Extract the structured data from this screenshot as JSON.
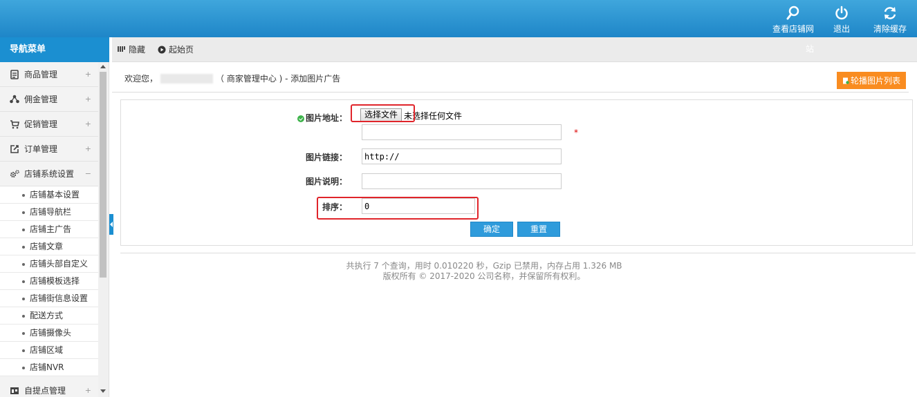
{
  "header": {
    "actions": [
      {
        "label": "查看店铺网",
        "icon": "search-icon"
      },
      {
        "label": "退出",
        "icon": "power-icon"
      },
      {
        "label": "清除缓存",
        "icon": "refresh-icon"
      }
    ],
    "overflow_text": "站",
    "background": "#1e86c8"
  },
  "sidebar": {
    "title": "导航菜单",
    "menus": [
      {
        "label": "商品管理",
        "icon": "product-icon",
        "toggle": "+"
      },
      {
        "label": "佣金管理",
        "icon": "commission-icon",
        "toggle": "+"
      },
      {
        "label": "促销管理",
        "icon": "cart-icon",
        "toggle": "+"
      },
      {
        "label": "订单管理",
        "icon": "order-icon",
        "toggle": "+"
      },
      {
        "label": "店铺系统设置",
        "icon": "settings-icon",
        "toggle": "−"
      }
    ],
    "sub_items": [
      "店铺基本设置",
      "店铺导航栏",
      "店铺主广告",
      "店铺文章",
      "店铺头部自定义",
      "店铺模板选择",
      "店铺街信息设置",
      "配送方式",
      "店铺摄像头",
      "店铺区域",
      "店铺NVR"
    ],
    "last_menu": {
      "label": "自提点管理",
      "icon": "pickup-icon",
      "toggle": "+"
    }
  },
  "toolbar": {
    "hide_label": "隐藏",
    "home_label": "起始页"
  },
  "page": {
    "welcome_prefix": "欢迎您，",
    "welcome_suffix": "（ 商家管理中心 ) - 添加图片广告",
    "list_button": "轮播图片列表",
    "accent": "#f98c20"
  },
  "form": {
    "image_address_label": "图片地址：",
    "file_button": "选择文件",
    "file_status": "未选择任何文件",
    "image_address_value": "",
    "required_mark": "*",
    "image_link_label": "图片链接：",
    "image_link_value": "http://",
    "image_desc_label": "图片说明：",
    "image_desc_value": "",
    "sort_label": "排序：",
    "sort_value": "0",
    "confirm": "确定",
    "reset": "重置"
  },
  "footer": {
    "line1": "共执行 7 个查询，用时 0.010220 秒，Gzip 已禁用，内存占用 1.326 MB",
    "line2": "版权所有 © 2017-2020 公司名称，并保留所有权利。"
  }
}
